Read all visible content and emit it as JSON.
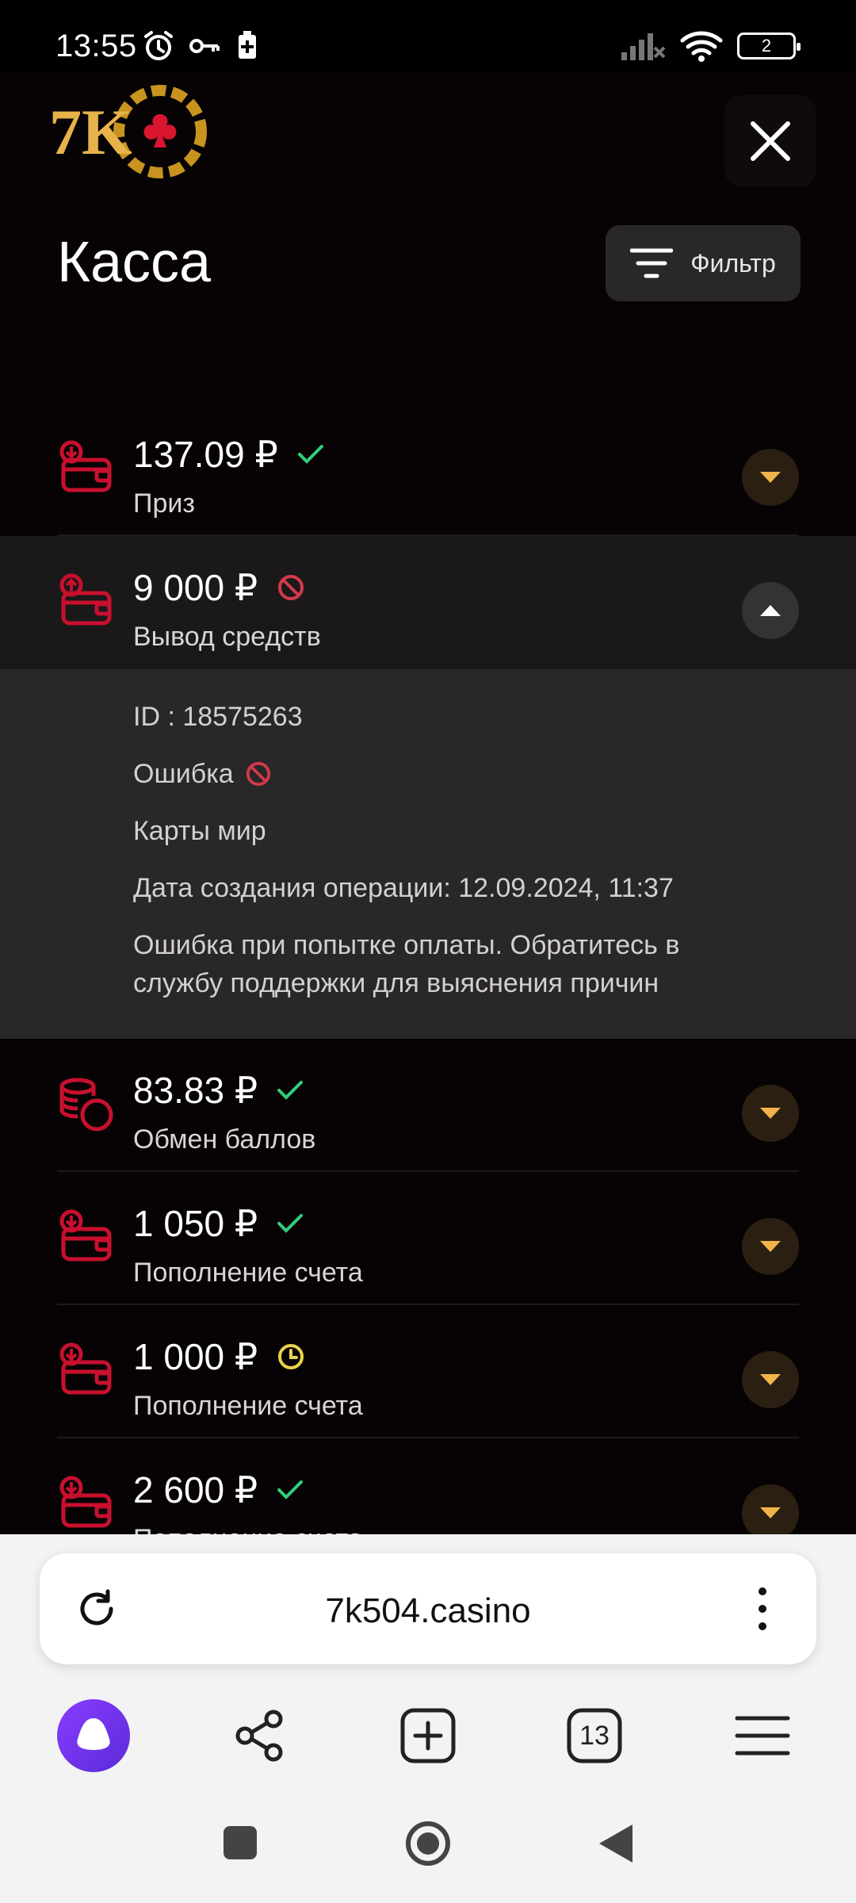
{
  "status": {
    "time": "13:55",
    "battery": "2"
  },
  "header": {
    "logo_text": "7K",
    "title": "Касса",
    "filter_label": "Фильтр"
  },
  "colors": {
    "accent_red": "#c8102e",
    "success": "#2fcf7e",
    "pending": "#e8d34a",
    "gold": "#f0b44a"
  },
  "transactions": [
    {
      "amount": "137.09 ₽",
      "type": "Приз",
      "status_icon": "check-icon",
      "icon": "wallet-in-icon"
    },
    {
      "amount": "9 000 ₽",
      "type": "Вывод средств",
      "status_icon": "blocked-icon",
      "icon": "wallet-out-icon"
    },
    {
      "amount": "83.83 ₽",
      "type": "Обмен баллов",
      "status_icon": "check-icon",
      "icon": "coins-icon"
    },
    {
      "amount": "1 050 ₽",
      "type": "Пополнение счета",
      "status_icon": "check-icon",
      "icon": "wallet-in-icon"
    },
    {
      "amount": "1 000 ₽",
      "type": "Пополнение счета",
      "status_icon": "clock-icon",
      "icon": "wallet-in-icon"
    },
    {
      "amount": "2 600 ₽",
      "type": "Пополнение счета",
      "status_icon": "check-icon",
      "icon": "wallet-in-icon"
    }
  ],
  "details": {
    "id": "ID : 18575263",
    "status": "Ошибка",
    "method": "Карты мир",
    "date": "Дата создания операции: 12.09.2024, 11:37",
    "message": "Ошибка при попытке оплаты. Обратитесь в службу поддержки для выяснения причин"
  },
  "browser": {
    "url": "7k504.casino",
    "tabs_count": "13"
  }
}
